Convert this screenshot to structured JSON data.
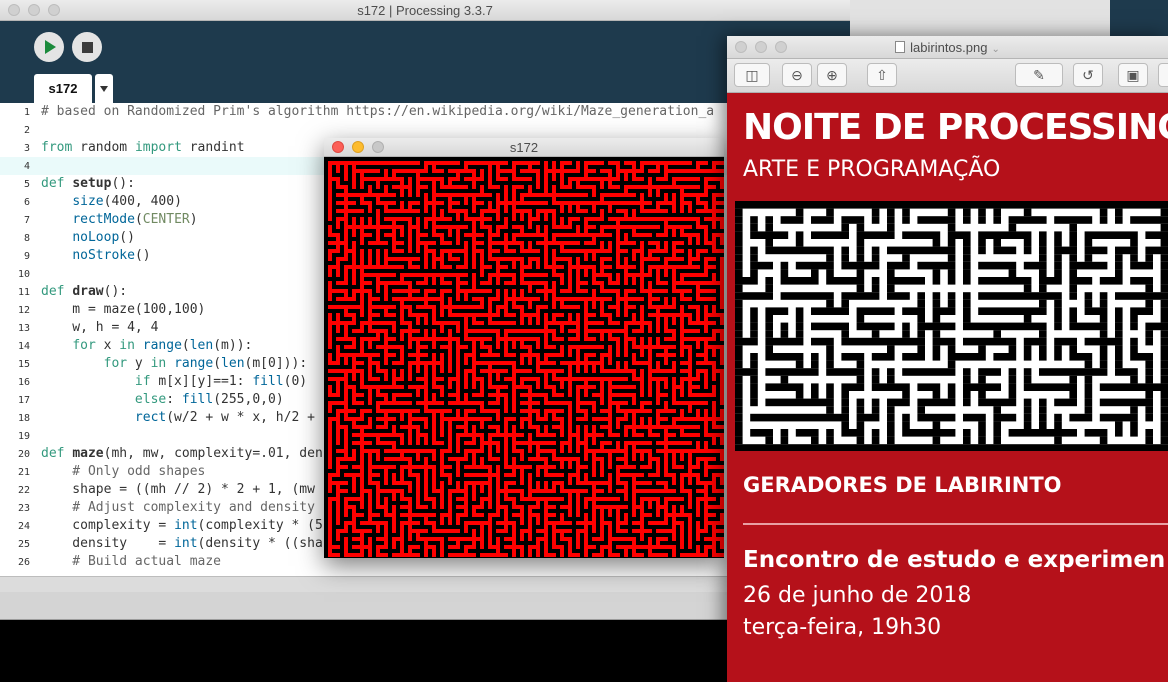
{
  "ide": {
    "title": "s172 | Processing 3.3.7",
    "tab_label": "s172",
    "code_lines": [
      {
        "n": "1",
        "text": "# based on Randomized Prim's algorithm https://en.wikipedia.org/wiki/Maze_generation_a"
      },
      {
        "n": "2",
        "text": ""
      },
      {
        "n": "3",
        "text": "from random import randint"
      },
      {
        "n": "4",
        "text": ""
      },
      {
        "n": "5",
        "text": "def setup():"
      },
      {
        "n": "6",
        "text": "    size(400, 400)"
      },
      {
        "n": "7",
        "text": "    rectMode(CENTER)"
      },
      {
        "n": "8",
        "text": "    noLoop()"
      },
      {
        "n": "9",
        "text": "    noStroke()"
      },
      {
        "n": "10",
        "text": ""
      },
      {
        "n": "11",
        "text": "def draw():"
      },
      {
        "n": "12",
        "text": "    m = maze(100,100)"
      },
      {
        "n": "13",
        "text": "    w, h = 4, 4"
      },
      {
        "n": "14",
        "text": "    for x in range(len(m)):"
      },
      {
        "n": "15",
        "text": "        for y in range(len(m[0])):"
      },
      {
        "n": "16",
        "text": "            if m[x][y]==1: fill(0)"
      },
      {
        "n": "17",
        "text": "            else: fill(255,0,0)"
      },
      {
        "n": "18",
        "text": "            rect(w/2 + w * x, h/2 +"
      },
      {
        "n": "19",
        "text": ""
      },
      {
        "n": "20",
        "text": "def maze(mh, mw, complexity=.01, den"
      },
      {
        "n": "21",
        "text": "    # Only odd shapes"
      },
      {
        "n": "22",
        "text": "    shape = ((mh // 2) * 2 + 1, (mw"
      },
      {
        "n": "23",
        "text": "    # Adjust complexity and density"
      },
      {
        "n": "24",
        "text": "    complexity = int(complexity * (5"
      },
      {
        "n": "25",
        "text": "    density    = int(density * ((sha"
      },
      {
        "n": "26",
        "text": "    # Build actual maze"
      }
    ],
    "current_line": "4"
  },
  "sketch": {
    "title": "s172",
    "wall_color": "#000000",
    "path_color": "#ff0000"
  },
  "preview": {
    "title": "labirintos.png",
    "poster": {
      "title": "NOITE DE PROCESSING",
      "subtitle": "ARTE E PROGRAMAÇÃO",
      "section": "GERADORES DE LABIRINTO",
      "event": "Encontro de estudo e experimen",
      "date": "26 de junho de 2018",
      "time": "terça-feira, 19h30",
      "bg_color": "#b5111a"
    }
  },
  "icons": {
    "run": "play-icon",
    "stop": "stop-icon",
    "tab_menu": "chevron-down-icon",
    "sidebar": "sidebar-icon",
    "zoom_out": "zoom-out-icon",
    "zoom_in": "zoom-in-icon",
    "share": "share-icon",
    "markup": "markup-pen-icon",
    "rotate": "rotate-icon",
    "toolbox": "toolbox-icon",
    "file": "file-icon"
  }
}
